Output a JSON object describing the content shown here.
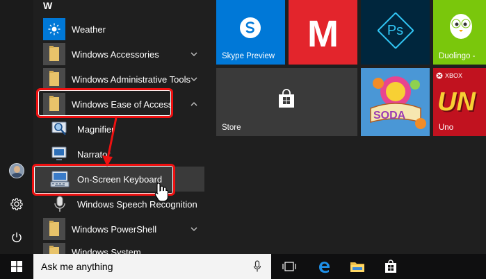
{
  "app_list": {
    "section_letter": "W",
    "items": [
      {
        "label": "Weather"
      },
      {
        "label": "Windows Accessories"
      },
      {
        "label": "Windows Administrative Tools"
      },
      {
        "label": "Windows Ease of Access"
      },
      {
        "label": "Magnifier"
      },
      {
        "label": "Narrator"
      },
      {
        "label": "On-Screen Keyboard"
      },
      {
        "label": "Windows Speech Recognition"
      },
      {
        "label": "Windows PowerShell"
      },
      {
        "label": "Windows System"
      }
    ]
  },
  "tiles": {
    "skype": {
      "label": "Skype Preview",
      "color": "#0078d7"
    },
    "marvel": {
      "glyph": "M",
      "color": "#e3252c"
    },
    "photoshop": {
      "glyph": "Ps",
      "color": "#00263d"
    },
    "duolingo": {
      "label": "Duolingo -",
      "color": "#7ac70c"
    },
    "store": {
      "label": "Store",
      "color": "#3a3a3a"
    },
    "candy": {
      "glyph": "SODA",
      "color": "#3b87c9"
    },
    "uno": {
      "badge": "XBOX",
      "label": "Uno",
      "glyph": "UN",
      "color": "#c1121f"
    }
  },
  "taskbar": {
    "search_placeholder": "Ask me anything"
  },
  "colors": {
    "accent": "#0078d7",
    "annotation": "#e11111",
    "menu_bg": "#1f1f1f",
    "taskbar_bg": "#0f0f10"
  }
}
